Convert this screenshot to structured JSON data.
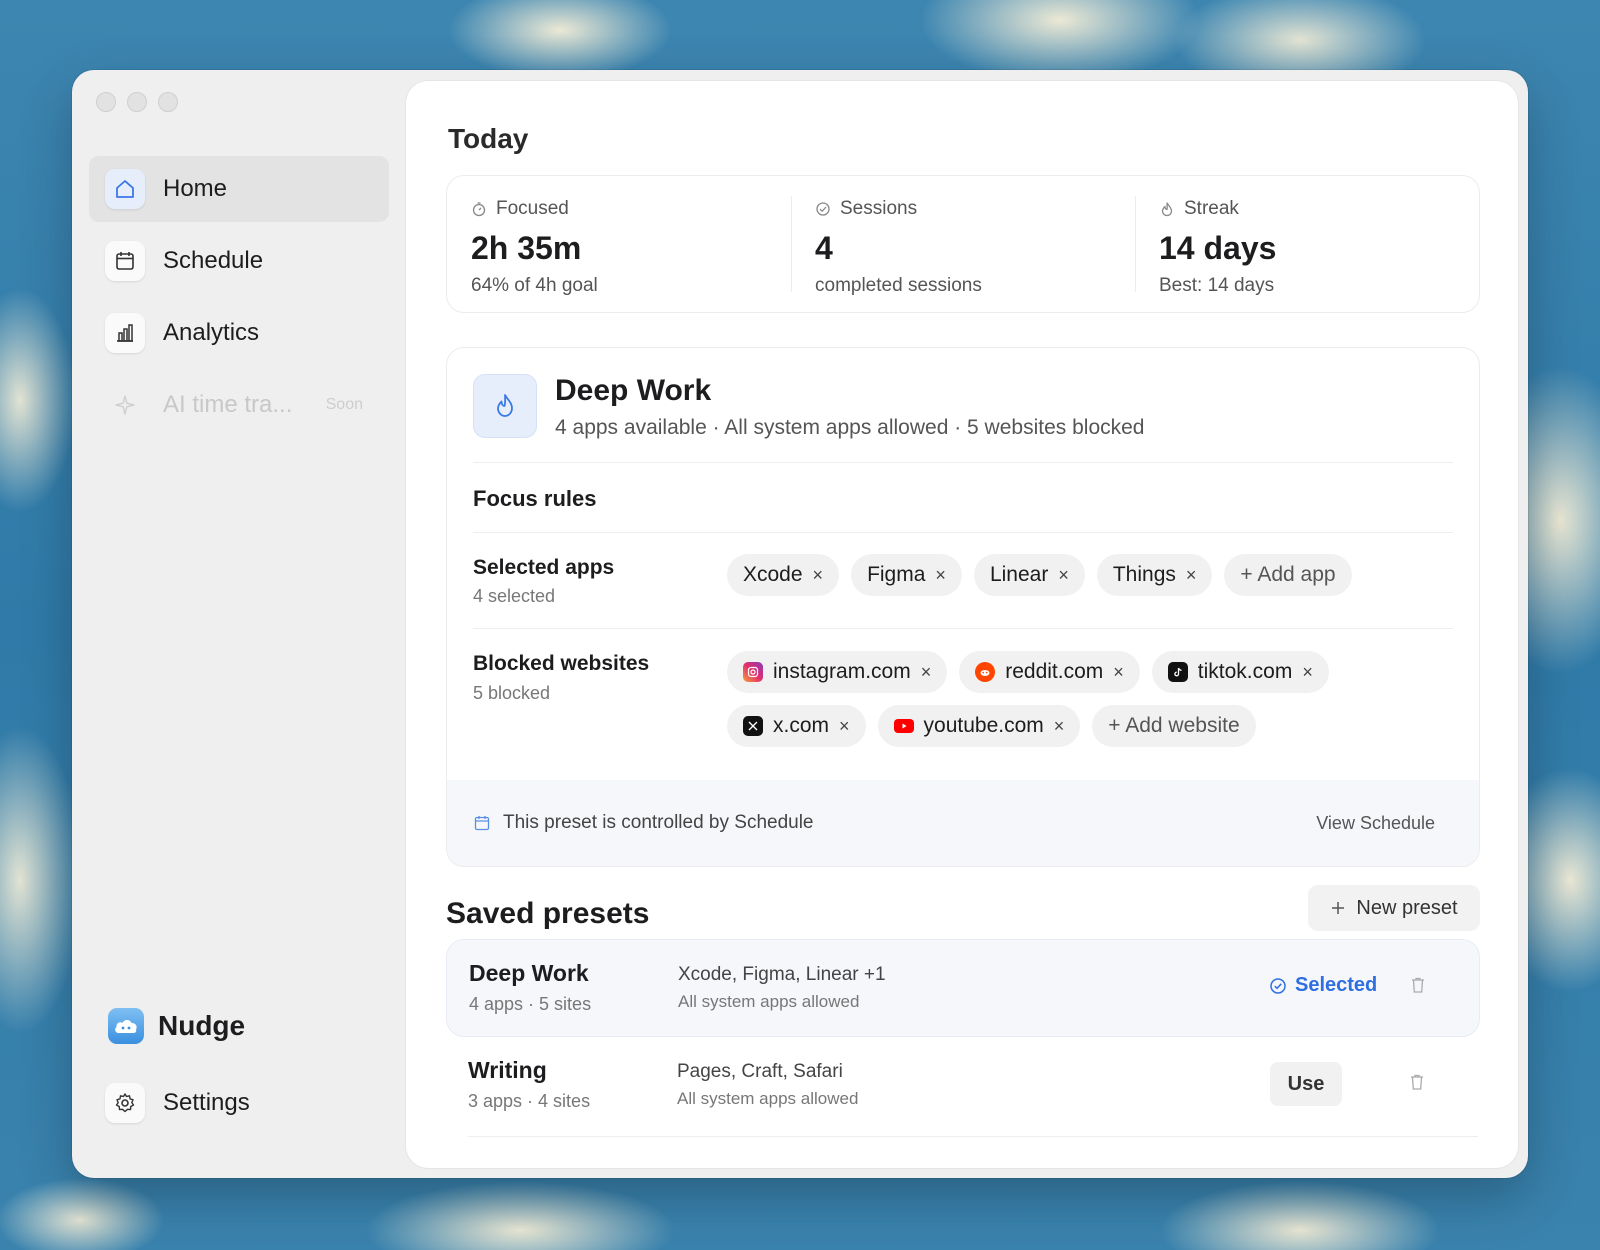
{
  "sidebar": {
    "items": [
      {
        "label": "Home",
        "icon": "home-icon"
      },
      {
        "label": "Schedule",
        "icon": "calendar-icon"
      },
      {
        "label": "Analytics",
        "icon": "bar-chart-icon"
      },
      {
        "label": "AI time tra...",
        "icon": "sparkle-icon",
        "badge": "Soon"
      }
    ],
    "brand": "Nudge",
    "settings": "Settings"
  },
  "today": {
    "title": "Today",
    "stats": [
      {
        "label": "Focused",
        "value": "2h 35m",
        "sub": "64% of 4h goal"
      },
      {
        "label": "Sessions",
        "value": "4",
        "sub": "completed sessions"
      },
      {
        "label": "Streak",
        "value": "14 days",
        "sub": "Best: 14 days"
      }
    ]
  },
  "preset": {
    "title": "Deep Work",
    "description": "4 apps available · All system apps allowed · 5 websites blocked",
    "rules_title": "Focus rules",
    "apps_label": "Selected apps",
    "apps_count": "4 selected",
    "apps": [
      "Xcode",
      "Figma",
      "Linear",
      "Things"
    ],
    "add_app": "+ Add app",
    "sites_label": "Blocked websites",
    "sites_count": "5 blocked",
    "sites": [
      "instagram.com",
      "reddit.com",
      "tiktok.com",
      "x.com",
      "youtube.com"
    ],
    "add_site": "+ Add website",
    "schedule_note": "This preset is controlled by Schedule",
    "view_schedule": "View Schedule",
    "remove_glyph": "×"
  },
  "saved": {
    "title": "Saved presets",
    "new_preset": "New preset",
    "rows": [
      {
        "name": "Deep Work",
        "summary": "4 apps · 5 sites",
        "apps": "Xcode, Figma, Linear +1",
        "allowed": "All system apps allowed",
        "status": "Selected"
      },
      {
        "name": "Writing",
        "summary": "3 apps · 4 sites",
        "apps": "Pages, Craft, Safari",
        "allowed": "All system apps allowed",
        "action": "Use"
      }
    ]
  },
  "colors": {
    "accent": "#2f6fe0",
    "sidebar_bg": "#efefef",
    "content_bg": "#ffffff"
  }
}
